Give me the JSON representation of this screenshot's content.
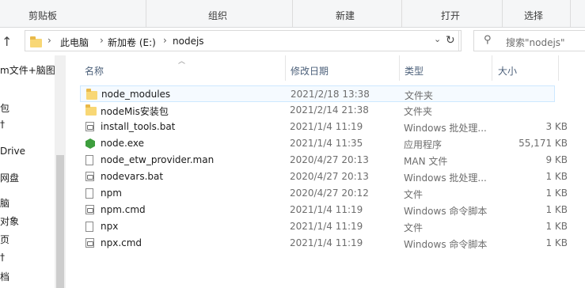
{
  "ribbon": {
    "groups": [
      "剪贴板",
      "组织",
      "新建",
      "打开",
      "选择"
    ]
  },
  "address": {
    "crumbs": [
      "此电脑",
      "新加卷 (E:)",
      "nodejs"
    ]
  },
  "search": {
    "placeholder": "搜索\"nodejs\""
  },
  "nav": {
    "items": [
      "m文件+脑图",
      "包",
      "†",
      "Drive",
      "网盘",
      "脑",
      "对象",
      "页",
      "†",
      "档"
    ]
  },
  "columns": {
    "name": "名称",
    "date": "修改日期",
    "type": "类型",
    "size": "大小"
  },
  "files": [
    {
      "name": "node_modules",
      "date": "2021/2/18 13:38",
      "type": "文件夹",
      "size": "",
      "icon": "folder-icon"
    },
    {
      "name": "nodeMis安装包",
      "date": "2021/2/14 21:38",
      "type": "文件夹",
      "size": "",
      "icon": "folder-icon"
    },
    {
      "name": "install_tools.bat",
      "date": "2021/1/4 11:19",
      "type": "Windows 批处理...",
      "size": "3 KB",
      "icon": "batch-file-icon"
    },
    {
      "name": "node.exe",
      "date": "2021/1/4 11:35",
      "type": "应用程序",
      "size": "55,171 KB",
      "icon": "nodejs-icon"
    },
    {
      "name": "node_etw_provider.man",
      "date": "2020/4/27 20:13",
      "type": "MAN 文件",
      "size": "9 KB",
      "icon": "file-icon"
    },
    {
      "name": "nodevars.bat",
      "date": "2020/4/27 20:13",
      "type": "Windows 批处理...",
      "size": "1 KB",
      "icon": "batch-file-icon"
    },
    {
      "name": "npm",
      "date": "2020/4/27 20:12",
      "type": "文件",
      "size": "1 KB",
      "icon": "file-icon"
    },
    {
      "name": "npm.cmd",
      "date": "2021/1/4 11:19",
      "type": "Windows 命令脚本",
      "size": "1 KB",
      "icon": "batch-file-icon"
    },
    {
      "name": "npx",
      "date": "2021/1/4 11:19",
      "type": "文件",
      "size": "1 KB",
      "icon": "file-icon"
    },
    {
      "name": "npx.cmd",
      "date": "2021/1/4 11:19",
      "type": "Windows 命令脚本",
      "size": "1 KB",
      "icon": "batch-file-icon"
    }
  ]
}
